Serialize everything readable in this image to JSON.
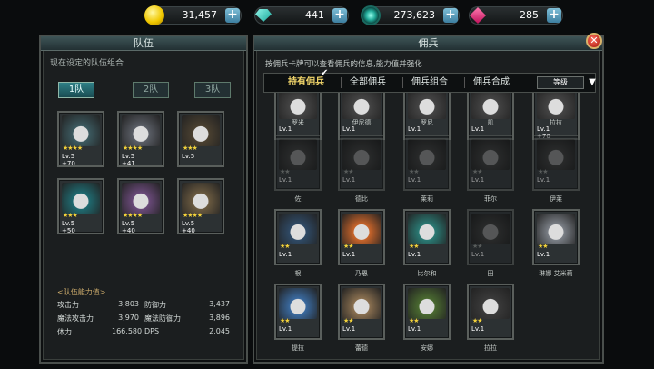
{
  "resources": [
    {
      "icon": "gold-coin-icon",
      "value": "31,457"
    },
    {
      "icon": "teal-gem-icon",
      "value": "441"
    },
    {
      "icon": "soul-orb-icon",
      "value": "273,623"
    },
    {
      "icon": "pink-crystal-icon",
      "value": "285"
    }
  ],
  "plus_label": "+",
  "left_panel": {
    "title": "队伍",
    "subtitle": "现在设定的队伍组合",
    "tabs": [
      "1队",
      "2队",
      "3队"
    ],
    "active_tab": 0,
    "cards": [
      {
        "lv": "Lv.5",
        "stars": "★★★★",
        "bonus": "+70",
        "color": "#3c5a60"
      },
      {
        "lv": "Lv.5",
        "stars": "★★★★",
        "bonus": "+41",
        "color": "#5a5e66"
      },
      {
        "lv": "Lv.5",
        "stars": "★★★",
        "bonus": "",
        "color": "#4a4030"
      },
      {
        "lv": "Lv.5",
        "stars": "★★★",
        "bonus": "+50",
        "color": "#1f6a70"
      },
      {
        "lv": "Lv.5",
        "stars": "★★★★",
        "bonus": "+40",
        "color": "#6a4a7a"
      },
      {
        "lv": "Lv.5",
        "stars": "★★★★",
        "bonus": "+40",
        "color": "#6a5a40"
      }
    ],
    "stats_title": "<队伍能力值>",
    "stats": [
      {
        "l1": "攻击力",
        "v1": "3,803",
        "l2": "防御力",
        "v2": "3,437"
      },
      {
        "l1": "魔法攻击力",
        "v1": "3,970",
        "l2": "魔法防御力",
        "v2": "3,896"
      },
      {
        "l1": "体力",
        "v1": "166,580",
        "l2": "DPS",
        "v2": "2,045"
      }
    ]
  },
  "right_panel": {
    "title": "佣兵",
    "description": "按佣兵卡牌可以查看佣兵的信息,能力值并强化",
    "tabs": [
      "持有佣兵",
      "全部佣兵",
      "佣兵组合",
      "佣兵合成"
    ],
    "active_tab": 0,
    "check_mark": "✔",
    "sort_label": "等级",
    "sort_arrow": "▼",
    "close_label": "✕",
    "row0": [
      {
        "lv": "Lv.1",
        "bonus": "",
        "name": "罗米"
      },
      {
        "lv": "Lv.1",
        "bonus": "",
        "name": "伊尼德"
      },
      {
        "lv": "Lv.1",
        "bonus": "",
        "name": "罗尼"
      },
      {
        "lv": "Lv.1",
        "bonus": "",
        "name": "凯"
      },
      {
        "lv": "Lv.1",
        "bonus": "+70",
        "name": "拉拉"
      }
    ],
    "grid": [
      {
        "lv": "Lv.1",
        "stars": "★★",
        "name": "佐",
        "dim": true,
        "color": "#555"
      },
      {
        "lv": "Lv.1",
        "stars": "★★",
        "name": "德比",
        "dim": true,
        "color": "#555"
      },
      {
        "lv": "Lv.1",
        "stars": "★★",
        "name": "莱莉",
        "dim": true,
        "color": "#555"
      },
      {
        "lv": "Lv.1",
        "stars": "★★",
        "name": "菲尔",
        "dim": true,
        "color": "#555"
      },
      {
        "lv": "Lv.1",
        "stars": "★★",
        "name": "伊莱",
        "dim": true,
        "color": "#555"
      },
      {
        "lv": "Lv.1",
        "stars": "★★",
        "name": "根",
        "dim": false,
        "color": "#2f4a66"
      },
      {
        "lv": "Lv.1",
        "stars": "★★",
        "name": "乃恩",
        "dim": false,
        "color": "#c8642a"
      },
      {
        "lv": "Lv.1",
        "stars": "★★",
        "name": "比尔和",
        "dim": false,
        "color": "#2a7a74"
      },
      {
        "lv": "Lv.1",
        "stars": "★★",
        "name": "田",
        "dim": true,
        "color": "#555"
      },
      {
        "lv": "Lv.1",
        "stars": "★★",
        "name": "琳娜 艾米莉",
        "dim": false,
        "color": "#7a7f86"
      },
      {
        "lv": "Lv.1",
        "stars": "★★",
        "name": "提拉",
        "dim": false,
        "color": "#3a6aa0"
      },
      {
        "lv": "Lv.1",
        "stars": "★★",
        "name": "蕾德",
        "dim": false,
        "color": "#8a7050"
      },
      {
        "lv": "Lv.1",
        "stars": "★★",
        "name": "安娜",
        "dim": false,
        "color": "#4a6a30"
      },
      {
        "lv": "Lv.1",
        "stars": "★★",
        "name": "拉拉",
        "dim": false,
        "color": "#3a3a3a"
      }
    ]
  }
}
